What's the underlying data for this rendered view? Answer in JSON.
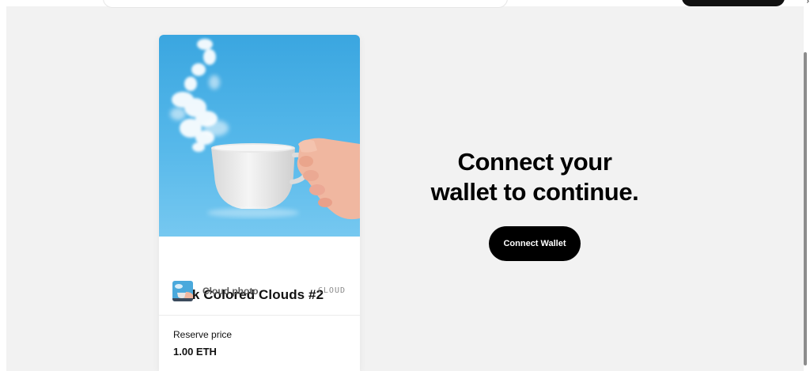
{
  "card": {
    "title": "Milk Colored Clouds #2",
    "creator_name": "Cloud photo",
    "collection_tag": "CLOUD",
    "price_label": "Reserve price",
    "price_value": "1.00 ETH"
  },
  "connect": {
    "headline_line1": "Connect your",
    "headline_line2": "wallet to continue.",
    "button_label": "Connect Wallet"
  },
  "colors": {
    "background": "#f2f2f2",
    "card": "#ffffff",
    "sky": "#4fb3e6",
    "button": "#000000",
    "button_text": "#ffffff"
  },
  "icons": {
    "creator_avatar": "cloud-photo-thumbnail",
    "artwork": "cup-in-sky-image"
  }
}
